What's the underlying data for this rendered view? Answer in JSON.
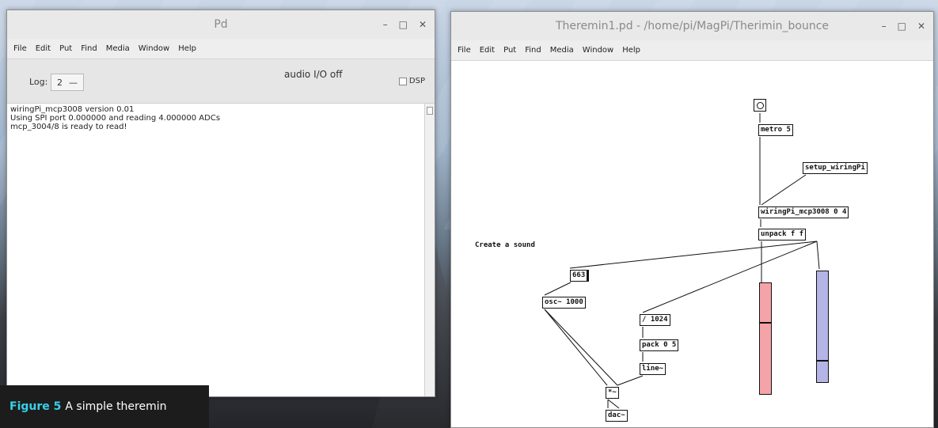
{
  "pd_window": {
    "title": "Pd",
    "menu": [
      "File",
      "Edit",
      "Put",
      "Find",
      "Media",
      "Window",
      "Help"
    ],
    "log_label": "Log:",
    "log_value": "2",
    "audio_status": "audio I/O off",
    "dsp_label": "DSP",
    "console_lines": [
      "wiringPi_mcp3008 version 0.01",
      "Using SPI port 0.000000 and reading 4.000000 ADCs",
      "mcp_3004/8 is ready to read!"
    ]
  },
  "theremin_window": {
    "title": "Theremin1.pd  - /home/pi/MagPi/Therimin_bounce",
    "menu": [
      "File",
      "Edit",
      "Put",
      "Find",
      "Media",
      "Window",
      "Help"
    ],
    "objects": {
      "metro": "metro 5",
      "setup": "setup_wiringPi",
      "mcp": "wiringPi_mcp3008 0 4",
      "unpack": "unpack f f",
      "num": "663",
      "osc": "osc~ 1000",
      "div": "/ 1024",
      "pack": "pack 0 5",
      "line": "line~",
      "mul": "*~",
      "dac": "dac~"
    },
    "comment": "Create a sound",
    "slider_levels": [
      0.65,
      0.2
    ],
    "slider_colors": [
      "#f4a3a8",
      "#b4b4e6"
    ]
  },
  "caption": {
    "label": "Figure 5",
    "text": "A simple theremin"
  }
}
